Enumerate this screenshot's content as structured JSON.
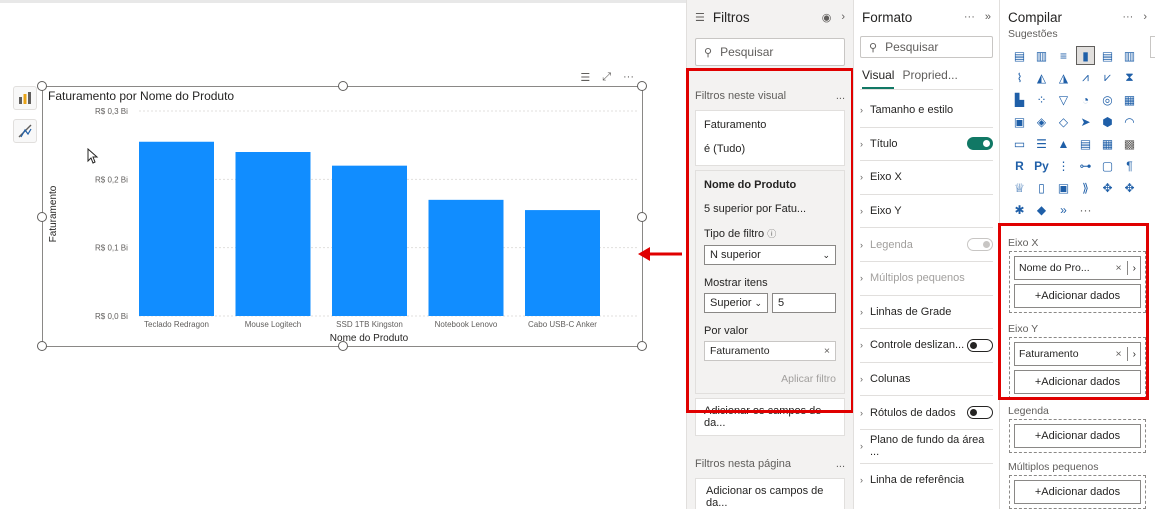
{
  "visual": {
    "title": "Faturamento por Nome do Produto"
  },
  "chart_data": {
    "type": "bar",
    "title": "Faturamento por Nome do Produto",
    "xlabel": "Nome do Produto",
    "ylabel": "Faturamento",
    "categories": [
      "Teclado Redragon",
      "Mouse Logitech",
      "SSD 1TB Kingston",
      "Notebook Lenovo",
      "Cabo USB-C Anker"
    ],
    "values": [
      0.255,
      0.24,
      0.22,
      0.17,
      0.155
    ],
    "yticks": [
      "R$ 0,0 Bi",
      "R$ 0,1 Bi",
      "R$ 0,2 Bi",
      "R$ 0,3 Bi"
    ],
    "ytick_values": [
      0,
      0.1,
      0.2,
      0.3
    ],
    "ylim": [
      0,
      0.3
    ],
    "grid": true,
    "bar_color": "#118dff"
  },
  "filters": {
    "title": "Filtros",
    "search_placeholder": "Pesquisar",
    "on_visual_label": "Filtros neste visual",
    "more": "...",
    "card1": {
      "field": "Faturamento",
      "value": "é (Tudo)"
    },
    "card2": {
      "field": "Nome do Produto",
      "summary": "5 superior por Fatu...",
      "filter_type_label": "Tipo de filtro",
      "filter_type_value": "N superior",
      "show_items_label": "Mostrar itens",
      "show_items_dir": "Superior",
      "show_items_count": "5",
      "by_value_label": "Por valor",
      "by_value_field": "Faturamento",
      "apply": "Aplicar filtro"
    },
    "add_fields": "Adicionar os campos de da...",
    "on_page_label": "Filtros nesta página",
    "add_fields_page": "Adicionar os campos de da..."
  },
  "format": {
    "title": "Formato",
    "search_placeholder": "Pesquisar",
    "tab_visual": "Visual",
    "tab_props": "Propried...",
    "sections": [
      {
        "label": "Tamanho e estilo"
      },
      {
        "label": "Título"
      },
      {
        "label": "Eixo X"
      },
      {
        "label": "Eixo Y"
      },
      {
        "label": "Legenda"
      },
      {
        "label": "Múltiplos pequenos"
      },
      {
        "label": "Linhas de Grade"
      },
      {
        "label": "Controle deslizan..."
      },
      {
        "label": "Colunas"
      },
      {
        "label": "Rótulos de dados"
      },
      {
        "label": "Plano de fundo da área ..."
      },
      {
        "label": "Linha de referência"
      }
    ]
  },
  "build": {
    "title": "Compilar",
    "suggestions": "Sugestões",
    "x_axis_label": "Eixo X",
    "x_field": "Nome do Pro...",
    "y_axis_label": "Eixo Y",
    "y_field": "Faturamento",
    "add_data": "+Adicionar dados",
    "legend_label": "Legenda",
    "small_multiples_label": "Múltiplos pequenos"
  },
  "colors": {
    "accent": "#117865",
    "highlight": "#e00000",
    "bar": "#118dff"
  }
}
